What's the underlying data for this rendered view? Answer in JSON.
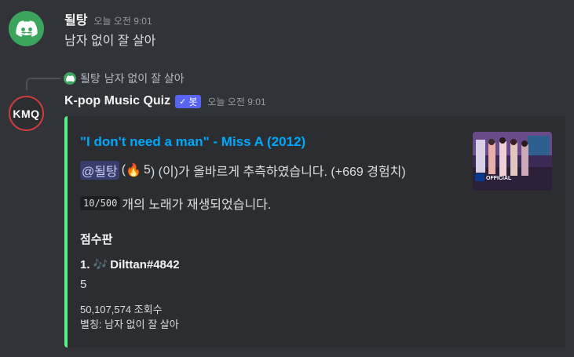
{
  "message1": {
    "username": "될탕",
    "timestamp": "오늘 오전 9:01",
    "text": "남자 없이 잘 살아"
  },
  "reply": {
    "username": "될탕",
    "text": "남자 없이 잘 살아"
  },
  "message2": {
    "username": "K-pop Music Quiz",
    "bot_tag": "봇",
    "timestamp": "오늘 오전 9:01",
    "avatar_text": "KMQ"
  },
  "embed": {
    "title": "\"I don't need a man\" - Miss A (2012)",
    "mention": "@될탕",
    "guess_open": "(",
    "fire_emoji": "🔥",
    "streak": "5",
    "guess_close": ") (이)가 올바르게 추측하였습니다. (+669 경험치)",
    "progress": "10/500",
    "progress_text": "개의 노래가 재생되었습니다.",
    "field_name": "점수판",
    "leader_rank": "1.",
    "leader_emoji": "🎶",
    "leader_name": "Dilttan#4842",
    "leader_score": "5",
    "views": "50,107,574 조회수",
    "alias": "별칭: 남자 없이 잘 살아",
    "thumbnail_badge": "OFFICIAL",
    "accent_color": "#57f287",
    "title_color": "#00a8fc"
  }
}
